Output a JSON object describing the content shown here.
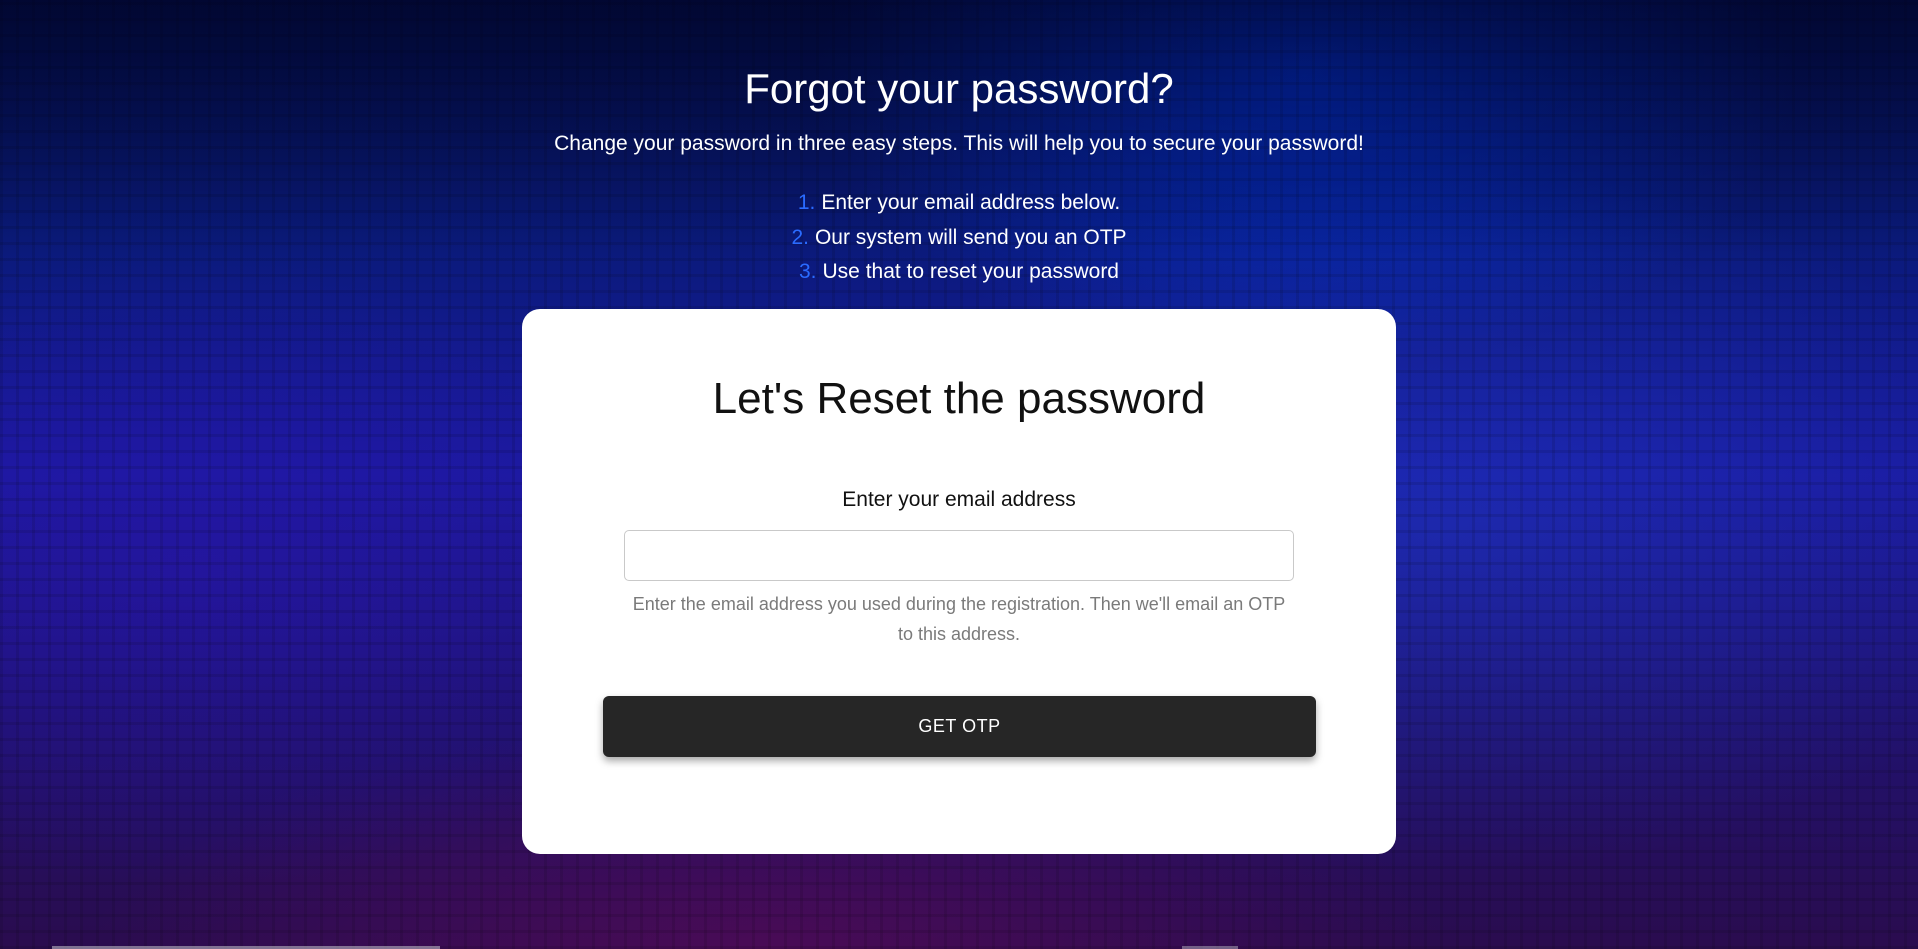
{
  "header": {
    "title": "Forgot your password?",
    "subtitle": "Change your password in three easy steps. This will help you to secure your password!"
  },
  "steps": [
    {
      "number": "1.",
      "text": "Enter your email address below."
    },
    {
      "number": "2.",
      "text": "Our system will send you an OTP"
    },
    {
      "number": "3.",
      "text": "Use that to reset your password"
    }
  ],
  "card": {
    "title": "Let's Reset the password",
    "email_label": "Enter your email address",
    "email_value": "",
    "email_placeholder": "",
    "help_text": "Enter the email address you used during the registration. Then we'll email an OTP to this address.",
    "button_label": "GET OTP"
  },
  "colors": {
    "step_number": "#2a6bff",
    "button_bg": "#262626",
    "card_bg": "#ffffff"
  }
}
